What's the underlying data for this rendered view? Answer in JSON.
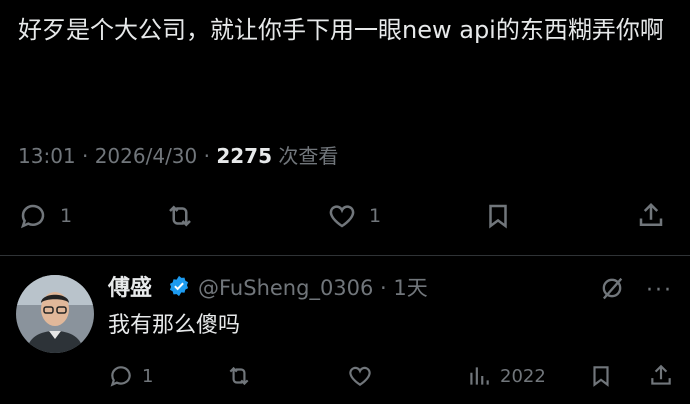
{
  "tweet": {
    "text": "好歹是个大公司，就让你手下用一眼new api的东西糊弄你啊",
    "time": "13:01 · 2026/4/30 · ",
    "views_count": "2275",
    "views_label": " 次查看",
    "replies": "1",
    "likes": "1"
  },
  "reply": {
    "name": "傅盛",
    "handle": "@FuSheng_0306 · 1天",
    "text": "我有那么傻吗",
    "replies": "1",
    "views": "2022"
  },
  "icons": {
    "reply": "comment-bubble-icon",
    "retweet": "retweet-icon",
    "like": "heart-icon",
    "bookmark": "bookmark-icon",
    "share": "share-upload-icon",
    "views": "analytics-bars-icon",
    "verified": "verified-badge-icon",
    "grok": "grok-icon",
    "more": "more-dots-icon"
  },
  "colors": {
    "background": "#000000",
    "text": "#e7e9ea",
    "muted": "#71767b",
    "verified": "#1d9bf0",
    "divider": "#2f3336"
  }
}
